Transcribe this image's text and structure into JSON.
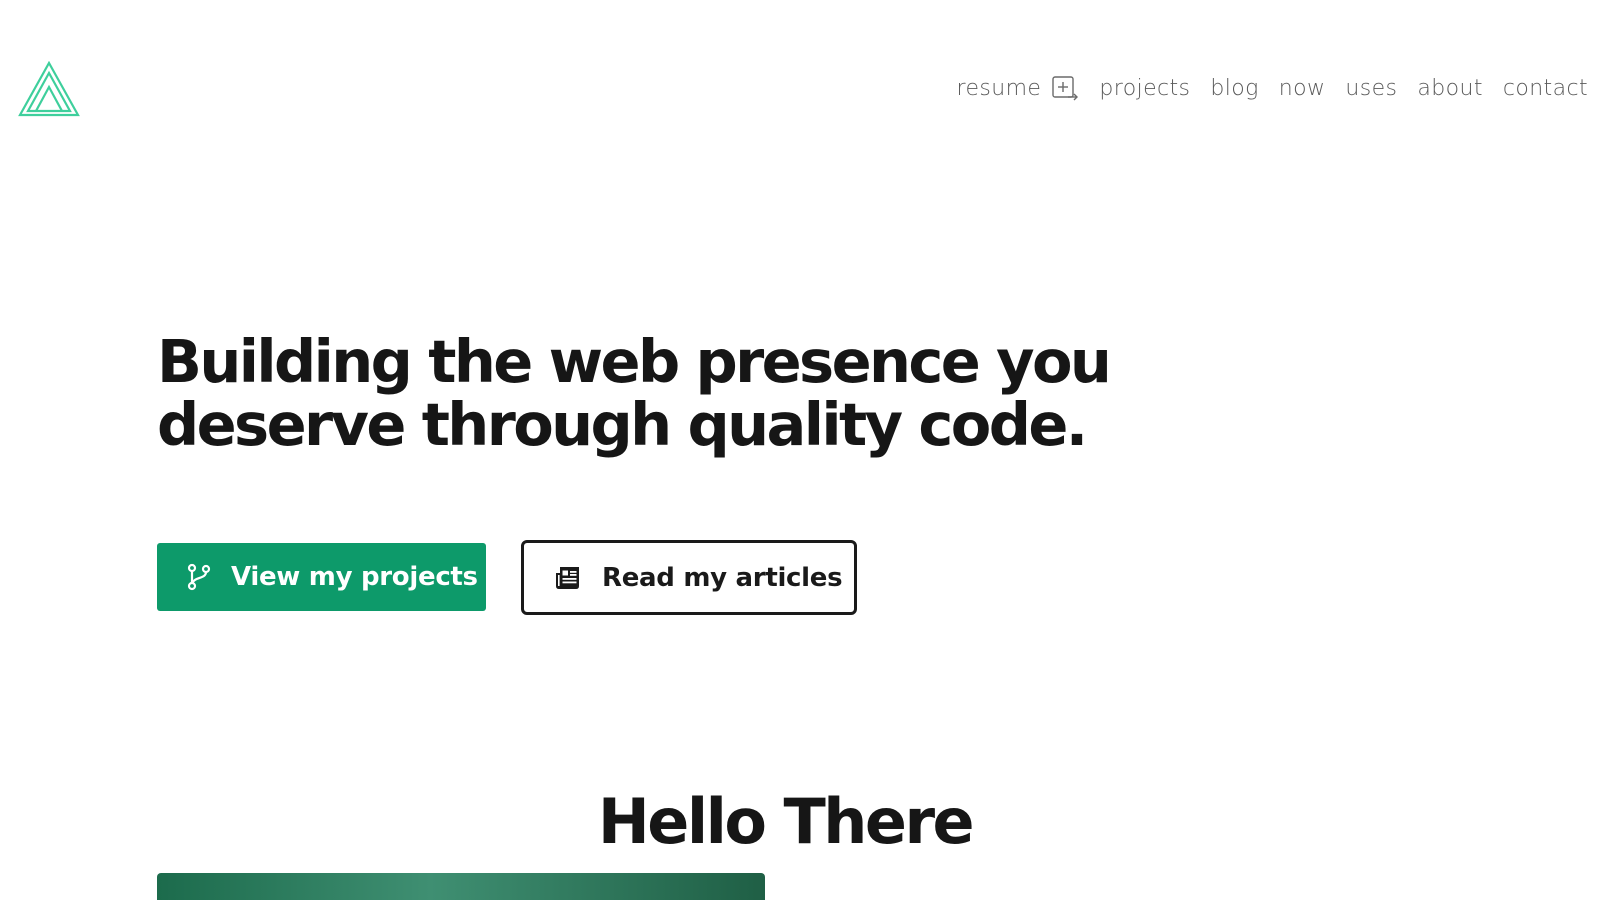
{
  "header": {
    "logo_icon": "triangle-logo-icon",
    "nav": [
      {
        "label": "resume",
        "icon": "external-document-icon"
      },
      {
        "label": "projects"
      },
      {
        "label": "blog"
      },
      {
        "label": "now"
      },
      {
        "label": "uses"
      },
      {
        "label": "about"
      },
      {
        "label": "contact"
      }
    ]
  },
  "hero": {
    "title_line1": "Building the web presence you",
    "title_line2": "deserve through quality code.",
    "primary_button": {
      "label": "View my projects",
      "icon": "git-branch-icon"
    },
    "secondary_button": {
      "label": "Read my articles",
      "icon": "newspaper-icon"
    }
  },
  "section": {
    "title": "Hello There"
  },
  "colors": {
    "accent": "#0d9a6a",
    "logo": "#3ecf9c",
    "text": "#161616",
    "nav_text": "#5a5a5a"
  }
}
